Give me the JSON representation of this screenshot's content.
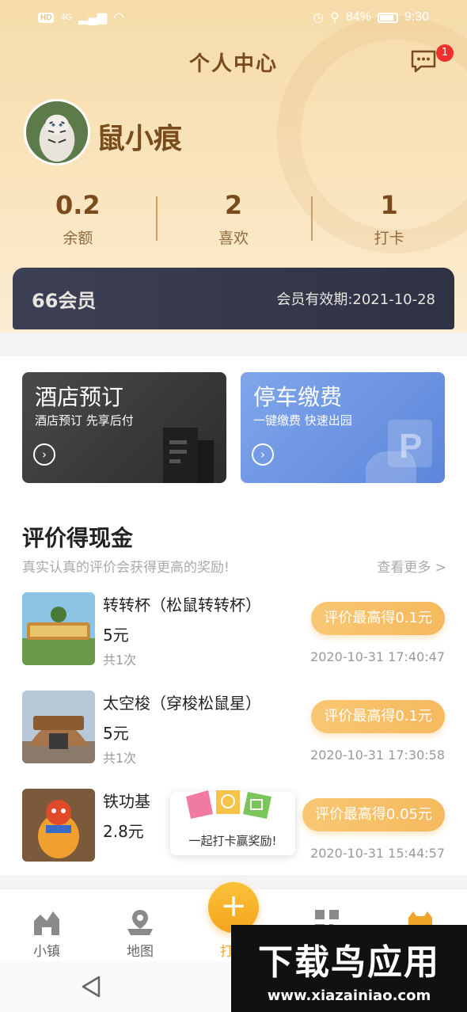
{
  "status_bar": {
    "signal_badge": "HD",
    "network": "4G",
    "battery": "84%",
    "time": "9:30"
  },
  "header": {
    "title": "个人中心",
    "message_badge": "1",
    "username": "鼠小痕"
  },
  "stats": [
    {
      "value": "0.2",
      "label": "余额"
    },
    {
      "value": "2",
      "label": "喜欢"
    },
    {
      "value": "1",
      "label": "打卡"
    }
  ],
  "membership": {
    "name": "66会员",
    "expiry": "会员有效期:2021-10-28"
  },
  "promos": {
    "hotel": {
      "title": "酒店预订",
      "subtitle": "酒店预订 先享后付"
    },
    "parking": {
      "title": "停车缴费",
      "subtitle": "一键缴费  快速出园"
    }
  },
  "review_section": {
    "title": "评价得现金",
    "subtitle": "真实认真的评价会获得更高的奖励!",
    "see_more": "查看更多 >"
  },
  "review_items": [
    {
      "name": "转转杯（松鼠转转杯）",
      "price": "5元",
      "count": "共1次",
      "reward": "评价最高得0.1元",
      "time": "2020-10-31 17:40:47"
    },
    {
      "name": "太空梭（穿梭松鼠星）",
      "price": "5元",
      "count": "共1次",
      "reward": "评价最高得0.1元",
      "time": "2020-10-31 17:30:58"
    },
    {
      "name": "铁功基",
      "price": "2.8元",
      "count": "",
      "reward": "评价最高得0.05元",
      "time": "2020-10-31 15:44:57"
    }
  ],
  "checkin_popup": {
    "text": "一起打卡赢奖励!"
  },
  "tabbar": {
    "town": "小镇",
    "map": "地图",
    "checkin": "打卡"
  },
  "watermark": {
    "main": "下载鸟应用",
    "url": "www.xiazainiao.com"
  },
  "colors": {
    "brand": "#7a4b1c",
    "accent": "#f6b95e",
    "badge": "#f0302d"
  }
}
